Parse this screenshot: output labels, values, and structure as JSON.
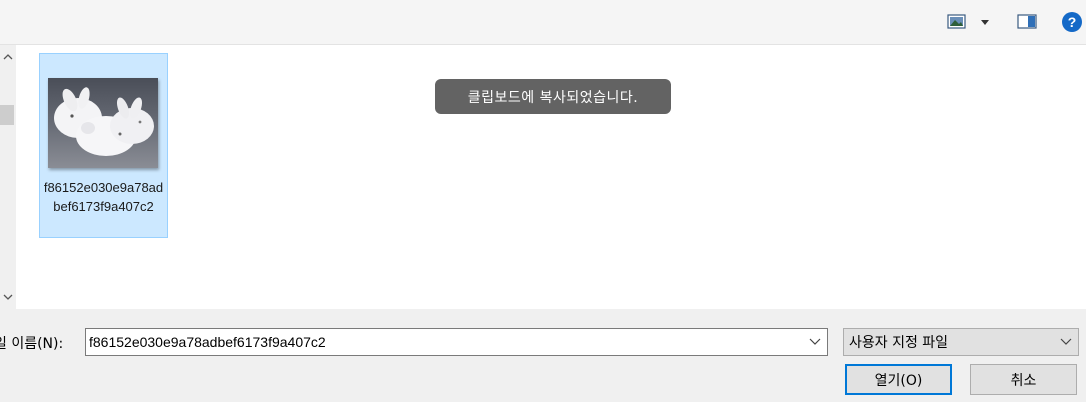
{
  "toolbar": {
    "view_icon": "change-view-icon",
    "view_dropdown_icon": "caret-down-icon",
    "preview_icon": "preview-pane-icon",
    "help_icon": "help-icon",
    "help_glyph": "?"
  },
  "scrollbar": {
    "up_glyph": "^",
    "down_glyph": "v"
  },
  "files": [
    {
      "name": "f86152e030e9a78adbef6173f9a407c2",
      "thumbnail": "white-rabbits-photo"
    }
  ],
  "toast": {
    "text": "클립보드에 복사되었습니다."
  },
  "footer": {
    "filename_label": "일 이름(N):",
    "filename_value": "f86152e030e9a78adbef6173f9a407c2",
    "filetype_value": "사용자 지정 파일",
    "open_label": "열기(O)",
    "cancel_label": "취소"
  },
  "colors": {
    "selected_bg": "#cce8ff",
    "selected_border": "#99d1ff",
    "accent": "#0078d7",
    "toast_bg": "#636363"
  }
}
